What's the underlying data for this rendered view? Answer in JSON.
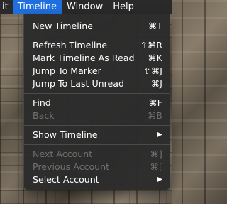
{
  "menubar": {
    "items": [
      {
        "label": "it"
      },
      {
        "label": "Timeline",
        "active": true
      },
      {
        "label": "Window"
      },
      {
        "label": "Help"
      }
    ]
  },
  "menu": {
    "groups": [
      {
        "items": [
          {
            "label": "New Timeline",
            "shortcut": "⌘T",
            "enabled": true
          }
        ]
      },
      {
        "items": [
          {
            "label": "Refresh Timeline",
            "shortcut": "⇧⌘R",
            "enabled": true
          },
          {
            "label": "Mark Timeline As Read",
            "shortcut": "⌘K",
            "enabled": true
          },
          {
            "label": "Jump To Marker",
            "shortcut": "⇧⌘J",
            "enabled": true
          },
          {
            "label": "Jump To Last Unread",
            "shortcut": "⌘J",
            "enabled": true
          }
        ]
      },
      {
        "items": [
          {
            "label": "Find",
            "shortcut": "⌘F",
            "enabled": true
          },
          {
            "label": "Back",
            "shortcut": "⌘B",
            "enabled": false
          }
        ]
      },
      {
        "items": [
          {
            "label": "Show Timeline",
            "submenu": true,
            "enabled": true
          }
        ]
      },
      {
        "items": [
          {
            "label": "Next Account",
            "shortcut": "⌘]",
            "enabled": false
          },
          {
            "label": "Previous Account",
            "shortcut": "⌘[",
            "enabled": false
          },
          {
            "label": "Select Account",
            "submenu": true,
            "enabled": true
          }
        ]
      }
    ],
    "submenu_arrow": "▶"
  },
  "colors": {
    "menubar_bg": "#2a2a2a",
    "active_menu_bg": "#1f6fe0",
    "menu_bg": "#2b2b2b",
    "disabled_text": "#717171",
    "separator": "#4b4b4b"
  }
}
